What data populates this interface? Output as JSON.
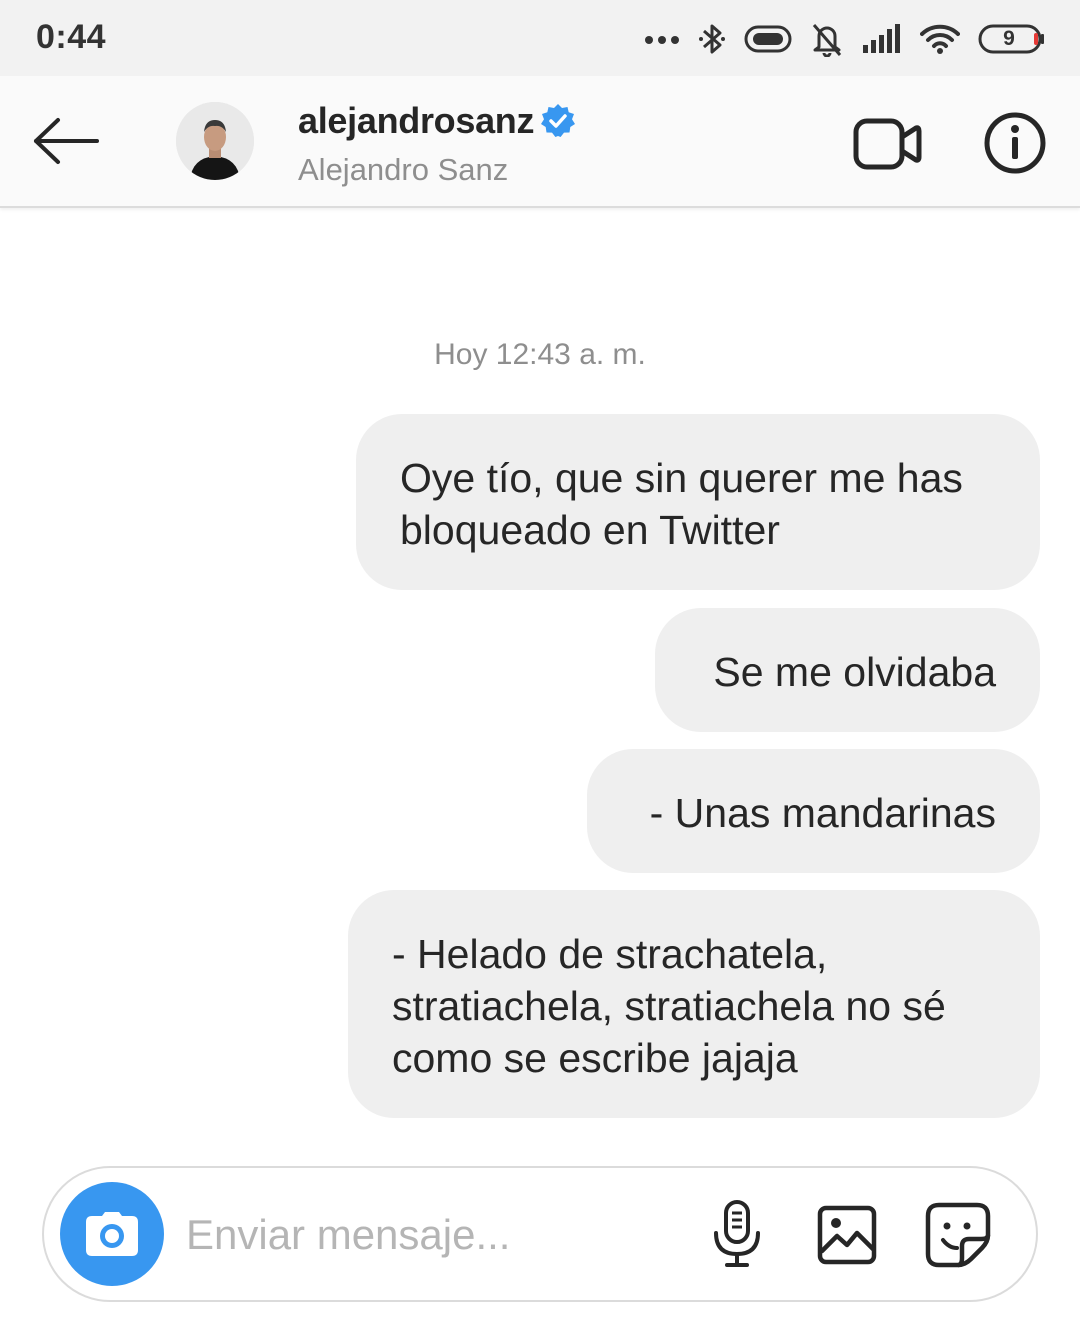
{
  "status_bar": {
    "time": "0:44",
    "battery_level": "9",
    "icons": [
      "more-dots-icon",
      "bluetooth-icon",
      "vibrate-icon",
      "bell-off-icon",
      "signal-icon",
      "wifi-icon",
      "battery-icon"
    ]
  },
  "header": {
    "username": "alejandrosanz",
    "full_name": "Alejandro Sanz",
    "verified": true,
    "icons": [
      "back-arrow-icon",
      "verified-badge-icon",
      "video-call-icon",
      "info-icon"
    ]
  },
  "conversation": {
    "timestamp": "Hoy 12:43 a. m.",
    "messages": [
      {
        "text": "Oye tío, que sin querer me has bloqueado en Twitter"
      },
      {
        "text": "Se me olvidaba"
      },
      {
        "text": "- Unas mandarinas"
      },
      {
        "text": "- Helado de strachatela, stratiachela, stratiachela no sé como se escribe jajaja"
      }
    ]
  },
  "composer": {
    "placeholder": "Enviar mensaje...",
    "icons": [
      "camera-icon",
      "microphone-icon",
      "gallery-icon",
      "sticker-icon"
    ]
  },
  "colors": {
    "accent": "#3897f0",
    "bubble": "#efefef",
    "status_bar_bg": "#f2f2f2",
    "header_bg": "#fafafa",
    "secondary_text": "#8e8e8e",
    "primary_text": "#262626"
  }
}
